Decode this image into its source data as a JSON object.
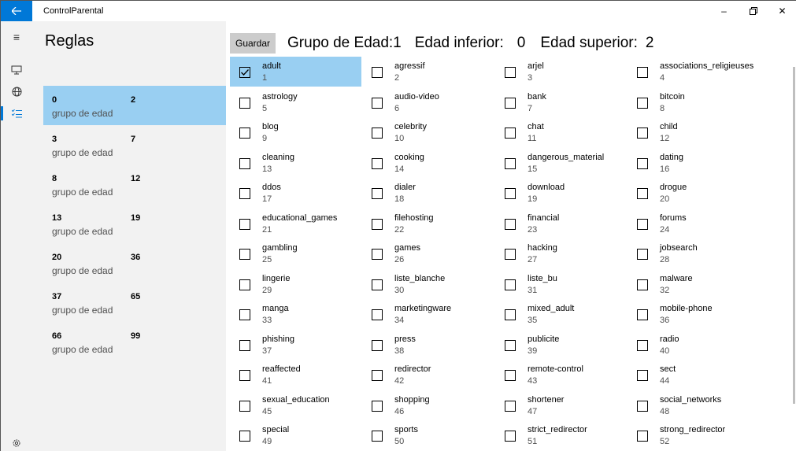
{
  "window": {
    "title": "ControlParental",
    "back_icon": "arrow-left-icon",
    "minimize": "–",
    "restore": "🗗",
    "close": "✕"
  },
  "nav": {
    "hamburger": "≡",
    "device": "🖳",
    "globe": "⊕",
    "rules": "⋮≡",
    "settings": "⚙"
  },
  "rules": {
    "title": "Reglas",
    "groups": [
      {
        "low": "0",
        "high": "2",
        "label": "grupo de edad",
        "selected": true
      },
      {
        "low": "3",
        "high": "7",
        "label": "grupo de edad"
      },
      {
        "low": "8",
        "high": "12",
        "label": "grupo de edad"
      },
      {
        "low": "13",
        "high": "19",
        "label": "grupo de edad"
      },
      {
        "low": "20",
        "high": "36",
        "label": "grupo de edad"
      },
      {
        "low": "37",
        "high": "65",
        "label": "grupo de edad"
      },
      {
        "low": "66",
        "high": "99",
        "label": "grupo de edad"
      }
    ]
  },
  "header": {
    "save_label": "Guardar",
    "group_label": "Grupo de Edad:1",
    "lower_label": "Edad inferior:",
    "lower_value": "0",
    "upper_label": "Edad superior:",
    "upper_value": "2"
  },
  "categories": [
    {
      "name": "adult",
      "id": "1",
      "checked": true
    },
    {
      "name": "agressif",
      "id": "2"
    },
    {
      "name": "arjel",
      "id": "3"
    },
    {
      "name": "associations_religieuses",
      "id": "4"
    },
    {
      "name": "astrology",
      "id": "5"
    },
    {
      "name": "audio-video",
      "id": "6"
    },
    {
      "name": "bank",
      "id": "7"
    },
    {
      "name": "bitcoin",
      "id": "8"
    },
    {
      "name": "blog",
      "id": "9"
    },
    {
      "name": "celebrity",
      "id": "10"
    },
    {
      "name": "chat",
      "id": "11"
    },
    {
      "name": "child",
      "id": "12"
    },
    {
      "name": "cleaning",
      "id": "13"
    },
    {
      "name": "cooking",
      "id": "14"
    },
    {
      "name": "dangerous_material",
      "id": "15"
    },
    {
      "name": "dating",
      "id": "16"
    },
    {
      "name": "ddos",
      "id": "17"
    },
    {
      "name": "dialer",
      "id": "18"
    },
    {
      "name": "download",
      "id": "19"
    },
    {
      "name": "drogue",
      "id": "20"
    },
    {
      "name": "educational_games",
      "id": "21"
    },
    {
      "name": "filehosting",
      "id": "22"
    },
    {
      "name": "financial",
      "id": "23"
    },
    {
      "name": "forums",
      "id": "24"
    },
    {
      "name": "gambling",
      "id": "25"
    },
    {
      "name": "games",
      "id": "26"
    },
    {
      "name": "hacking",
      "id": "27"
    },
    {
      "name": "jobsearch",
      "id": "28"
    },
    {
      "name": "lingerie",
      "id": "29"
    },
    {
      "name": "liste_blanche",
      "id": "30"
    },
    {
      "name": "liste_bu",
      "id": "31"
    },
    {
      "name": "malware",
      "id": "32"
    },
    {
      "name": "manga",
      "id": "33"
    },
    {
      "name": "marketingware",
      "id": "34"
    },
    {
      "name": "mixed_adult",
      "id": "35"
    },
    {
      "name": "mobile-phone",
      "id": "36"
    },
    {
      "name": "phishing",
      "id": "37"
    },
    {
      "name": "press",
      "id": "38"
    },
    {
      "name": "publicite",
      "id": "39"
    },
    {
      "name": "radio",
      "id": "40"
    },
    {
      "name": "reaffected",
      "id": "41"
    },
    {
      "name": "redirector",
      "id": "42"
    },
    {
      "name": "remote-control",
      "id": "43"
    },
    {
      "name": "sect",
      "id": "44"
    },
    {
      "name": "sexual_education",
      "id": "45"
    },
    {
      "name": "shopping",
      "id": "46"
    },
    {
      "name": "shortener",
      "id": "47"
    },
    {
      "name": "social_networks",
      "id": "48"
    },
    {
      "name": "special",
      "id": "49"
    },
    {
      "name": "sports",
      "id": "50"
    },
    {
      "name": "strict_redirector",
      "id": "51"
    },
    {
      "name": "strong_redirector",
      "id": "52"
    }
  ],
  "colors": {
    "accent": "#0078d7",
    "selection": "#99cff2",
    "pane": "#f2f2f2"
  }
}
